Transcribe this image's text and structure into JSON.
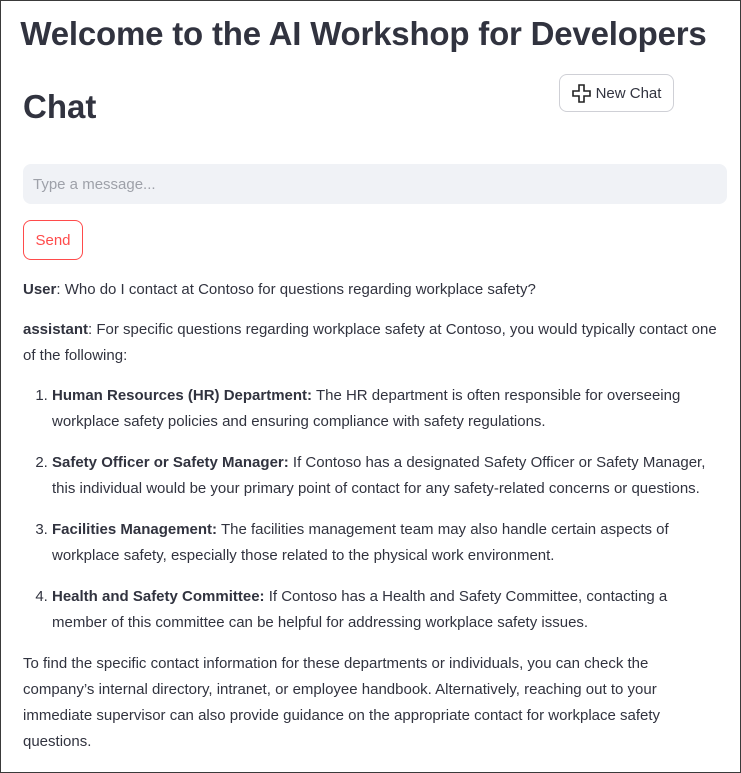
{
  "header": {
    "title": "Welcome to the AI Workshop for Developers"
  },
  "chat": {
    "heading": "Chat",
    "new_chat_label": "New Chat",
    "input_placeholder": "Type a message...",
    "input_value": "",
    "send_label": "Send"
  },
  "conversation": {
    "user_role": "User",
    "user_text": ": Who do I contact at Contoso for questions regarding workplace safety?",
    "assistant_role": "assistant",
    "assistant_intro": ": For specific questions regarding workplace safety at Contoso, you would typically contact one of the following:",
    "items": [
      {
        "title": "Human Resources (HR) Department:",
        "text": " The HR department is often responsible for overseeing workplace safety policies and ensuring compliance with safety regulations."
      },
      {
        "title": "Safety Officer or Safety Manager:",
        "text": " If Contoso has a designated Safety Officer or Safety Manager, this individual would be your primary point of contact for any safety-related concerns or questions."
      },
      {
        "title": "Facilities Management:",
        "text": " The facilities management team may also handle certain aspects of workplace safety, especially those related to the physical work environment."
      },
      {
        "title": "Health and Safety Committee:",
        "text": " If Contoso has a Health and Safety Committee, contacting a member of this committee can be helpful for addressing workplace safety issues."
      }
    ],
    "closing": "To find the specific contact information for these departments or individuals, you can check the company’s internal directory, intranet, or employee handbook. Alternatively, reaching out to your immediate supervisor can also provide guidance on the appropriate contact for workplace safety questions."
  },
  "icons": {
    "new_chat": "plus-icon"
  },
  "colors": {
    "accent": "#ff4b4b",
    "input_bg": "#f0f2f6",
    "text": "#31333f"
  }
}
